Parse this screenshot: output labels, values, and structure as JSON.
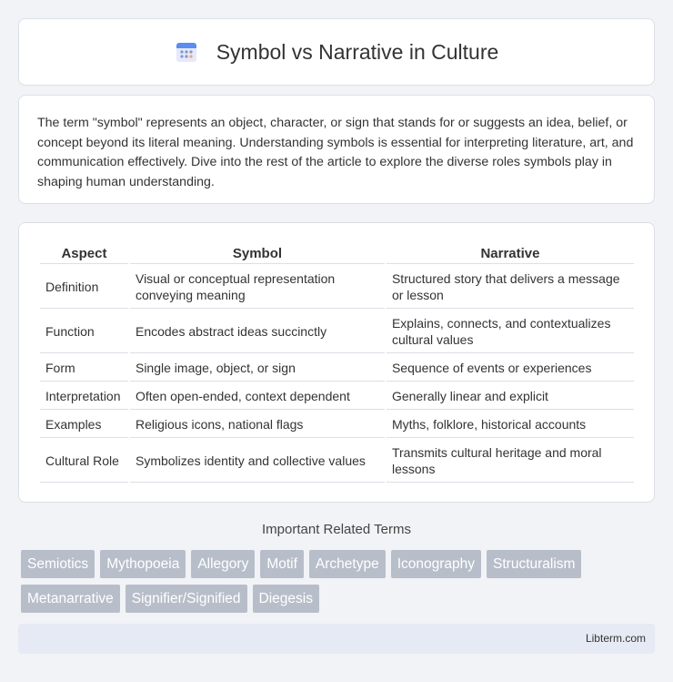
{
  "header": {
    "title": "Symbol vs Narrative in Culture",
    "icon": "calendar-grid-icon"
  },
  "intro": {
    "text": "The term \"symbol\" represents an object, character, or sign that stands for or suggests an idea, belief, or concept beyond its literal meaning. Understanding symbols is essential for interpreting literature, art, and communication effectively. Dive into the rest of the article to explore the diverse roles symbols play in shaping human understanding."
  },
  "table": {
    "headers": [
      "Aspect",
      "Symbol",
      "Narrative"
    ],
    "rows": [
      [
        "Definition",
        "Visual or conceptual representation conveying meaning",
        "Structured story that delivers a message or lesson"
      ],
      [
        "Function",
        "Encodes abstract ideas succinctly",
        "Explains, connects, and contextualizes cultural values"
      ],
      [
        "Form",
        "Single image, object, or sign",
        "Sequence of events or experiences"
      ],
      [
        "Interpretation",
        "Often open-ended, context dependent",
        "Generally linear and explicit"
      ],
      [
        "Examples",
        "Religious icons, national flags",
        "Myths, folklore, historical accounts"
      ],
      [
        "Cultural Role",
        "Symbolizes identity and collective values",
        "Transmits cultural heritage and moral lessons"
      ]
    ]
  },
  "related": {
    "title": "Important Related Terms",
    "tags_row1": [
      "Semiotics",
      "Mythopoeia",
      "Allegory",
      "Motif",
      "Archetype",
      "Iconography",
      "Structuralism"
    ],
    "tags_row2": [
      "Metanarrative",
      "Signifier/Signified",
      "Diegesis"
    ]
  },
  "footer": {
    "site": "Libterm.com"
  },
  "colors": {
    "background": "#f2f3f7",
    "tag": "#b8bec9",
    "footer": "#e6eaf4",
    "icon_accent": "#5b8def"
  }
}
